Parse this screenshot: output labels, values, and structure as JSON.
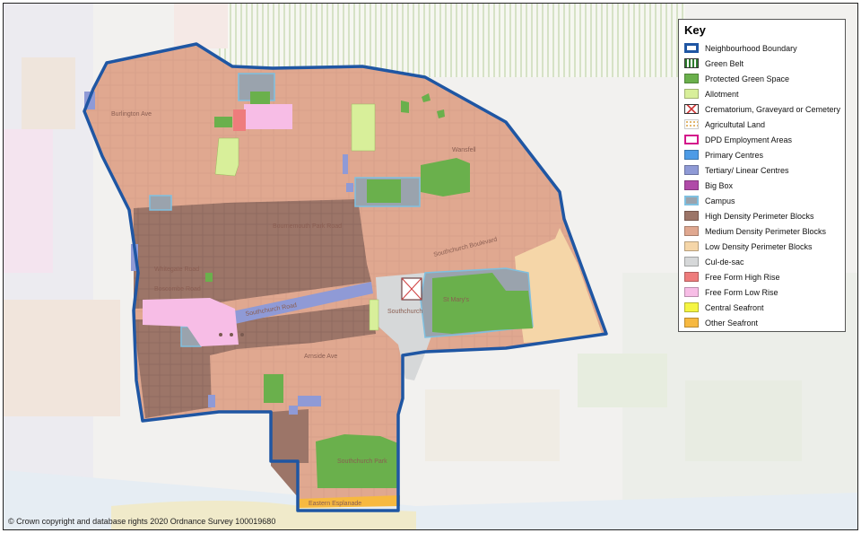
{
  "map": {
    "copyright": "© Crown copyright and database rights 2020 Ordnance Survey 100019680",
    "legend": {
      "title": "Key",
      "items": [
        {
          "label": "Neighbourhood Boundary",
          "color": "#1f56a3",
          "style": "boundary",
          "icon": "neighbourhood-boundary-icon"
        },
        {
          "label": "Green Belt",
          "color": "#2f7d2f",
          "style": "stripes",
          "icon": "green-belt-icon"
        },
        {
          "label": "Protected Green Space",
          "color": "#6ab04c",
          "style": "fill",
          "icon": "protected-green-space-icon"
        },
        {
          "label": "Allotment",
          "color": "#d8ef9a",
          "style": "fill",
          "icon": "allotment-icon"
        },
        {
          "label": "Crematorium, Graveyard or Cemetery",
          "color": "#d04040",
          "style": "cross",
          "icon": "crematorium-icon"
        },
        {
          "label": "Agricultutal Land",
          "color": "#e0b060",
          "style": "dots",
          "icon": "agricultural-land-icon"
        },
        {
          "label": "DPD Employment Areas",
          "color": "#d4158a",
          "style": "outline",
          "icon": "dpd-employment-icon"
        },
        {
          "label": "Primary Centres",
          "color": "#4d9be6",
          "style": "fill",
          "icon": "primary-centres-icon"
        },
        {
          "label": "Tertiary/ Linear Centres",
          "color": "#8f9ad6",
          "style": "fill",
          "icon": "tertiary-centres-icon"
        },
        {
          "label": "Big Box",
          "color": "#b04aa8",
          "style": "fill",
          "icon": "big-box-icon"
        },
        {
          "label": "Campus",
          "color": "#9aa3ad",
          "style": "campus",
          "icon": "campus-icon"
        },
        {
          "label": "High Density Perimeter Blocks",
          "color": "#9c7568",
          "style": "fill",
          "icon": "high-density-icon"
        },
        {
          "label": "Medium Density Perimeter Blocks",
          "color": "#e0a890",
          "style": "fill",
          "icon": "medium-density-icon"
        },
        {
          "label": "Low Density Perimeter Blocks",
          "color": "#f5d6a8",
          "style": "fill",
          "icon": "low-density-icon"
        },
        {
          "label": "Cul-de-sac",
          "color": "#d6d8d9",
          "style": "fill",
          "icon": "cul-de-sac-icon"
        },
        {
          "label": "Free Form High Rise",
          "color": "#ee7c7c",
          "style": "fill",
          "icon": "free-form-high-rise-icon"
        },
        {
          "label": "Free Form Low Rise",
          "color": "#f7bde6",
          "style": "fill",
          "icon": "free-form-low-rise-icon"
        },
        {
          "label": "Central Seafront",
          "color": "#f5f542",
          "style": "fill",
          "icon": "central-seafront-icon"
        },
        {
          "label": "Other Seafront",
          "color": "#f7b940",
          "style": "fill",
          "icon": "other-seafront-icon"
        }
      ]
    },
    "place_labels": {
      "southchurch": "Southchurch",
      "southchurch_boulevard": "Southchurch Boulevard",
      "southchurch_road": "Southchurch Road",
      "southchurch_park": "Southchurch Park",
      "eastern_esplanade": "Eastern Esplanade",
      "arnside_ave": "Arnside Ave",
      "burlington_ave": "Burlington Ave",
      "whitegate_road": "Whitegate Road",
      "boscombe_road": "Boscombe Road",
      "bournemouth": "Bournemouth Park Road",
      "wansfell": "Wansfell",
      "st_marys": "St Mary's"
    }
  }
}
